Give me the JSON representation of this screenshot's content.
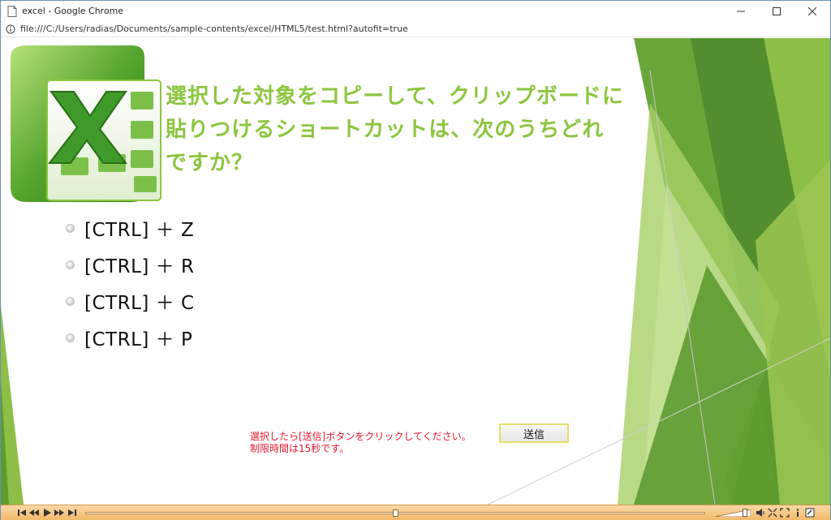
{
  "window": {
    "title": "excel - Google Chrome",
    "controls": {
      "minimize": "—",
      "maximize": "☐",
      "close": "✕"
    }
  },
  "address": {
    "url": "file:///C:/Users/radias/Documents/sample-contents/excel/HTML5/test.html?autofit=true"
  },
  "quiz": {
    "question_lines": [
      "選択した対象をコピーして、クリップボードに",
      "貼りつけるショートカットは、次のうちどれ",
      "ですか？"
    ],
    "options": [
      "[CTRL] ＋ Z",
      "[CTRL] ＋ R",
      "[CTRL] ＋ C",
      "[CTRL] ＋ P"
    ],
    "instructions": [
      "選択したら[送信]ボタンをクリックしてください。",
      "制限時間は15秒です。"
    ],
    "submit_label": "送信"
  },
  "player": {
    "seek_progress": 0.5,
    "volume_level": 0.85
  },
  "colors": {
    "question_text": "#8cc63f",
    "instruction_text": "#e8192c",
    "accent_green": "#7ab532",
    "player_bar": "#f2b96a"
  }
}
